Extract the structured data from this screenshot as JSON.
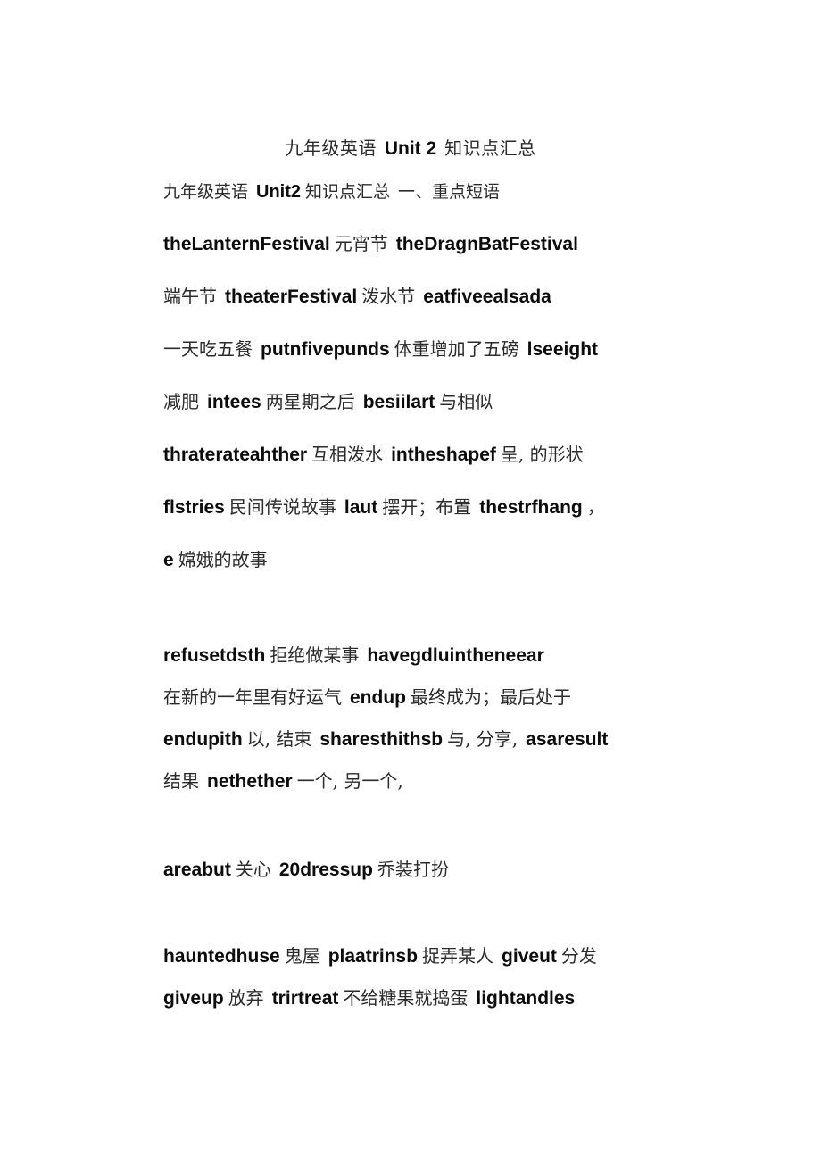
{
  "document": {
    "title_runs": [
      {
        "type": "cn",
        "text": "九年级英语"
      },
      {
        "type": "en",
        "text": "Unit 2"
      },
      {
        "type": "cn",
        "text": "知识点汇总"
      }
    ],
    "title_plain": "九年级英语 Unit 2 知识点汇总",
    "page_background": "#ffffff",
    "text_color": "#111111",
    "blocks": [
      {
        "name": "intro",
        "lines": [
          {
            "plain": "九年级英语 Unit2 知识点汇总 一、重点短语",
            "runs": [
              {
                "type": "cn",
                "text": "九年级英语"
              },
              {
                "type": "en",
                "text": "Unit2"
              },
              {
                "type": "cn",
                "text": "知识点汇总"
              },
              {
                "type": "cn",
                "text": "一、重点短语"
              }
            ]
          }
        ]
      },
      {
        "name": "phrases-group-1",
        "lines": [
          {
            "plain": "theLanternFestival 元宵节 theDragnBatFestival",
            "runs": [
              {
                "type": "en",
                "text": "theLanternFestival"
              },
              {
                "type": "cn",
                "text": "元宵节"
              },
              {
                "type": "en",
                "text": "theDragnBatFestival"
              }
            ]
          },
          {
            "plain": "端午节 theaterFestival 泼水节 eatfiveealsada",
            "runs": [
              {
                "type": "cn",
                "text": "端午节"
              },
              {
                "type": "en",
                "text": "theaterFestival"
              },
              {
                "type": "cn",
                "text": "泼水节"
              },
              {
                "type": "en",
                "text": "eatfiveealsada"
              }
            ]
          },
          {
            "plain": "一天吃五餐 putnfivepunds 体重增加了五磅 lseeight",
            "runs": [
              {
                "type": "cn",
                "text": "一天吃五餐"
              },
              {
                "type": "en",
                "text": "putnfivepunds"
              },
              {
                "type": "cn",
                "text": "体重增加了五磅"
              },
              {
                "type": "en",
                "text": "lseeight"
              }
            ]
          },
          {
            "plain": "减肥 intees 两星期之后 besiilart 与相似",
            "runs": [
              {
                "type": "cn",
                "text": "减肥"
              },
              {
                "type": "en",
                "text": "intees"
              },
              {
                "type": "cn",
                "text": "两星期之后"
              },
              {
                "type": "en",
                "text": "besiilart"
              },
              {
                "type": "cn",
                "text": "与相似"
              }
            ]
          },
          {
            "plain": "thraterateahther 互相泼水 intheshapef 呈, 的形状",
            "runs": [
              {
                "type": "en",
                "text": "thraterateahther"
              },
              {
                "type": "cn",
                "text": "互相泼水"
              },
              {
                "type": "en",
                "text": "intheshapef"
              },
              {
                "type": "cn",
                "text": "呈, 的形状"
              }
            ]
          },
          {
            "plain": "flstries 民间传说故事 laut 摆开；布置 thestrfhang ，",
            "runs": [
              {
                "type": "en",
                "text": "flstries"
              },
              {
                "type": "cn",
                "text": "民间传说故事"
              },
              {
                "type": "en",
                "text": "laut"
              },
              {
                "type": "cn",
                "text": "摆开；布置"
              },
              {
                "type": "en",
                "text": "thestrfhang"
              },
              {
                "type": "cn",
                "text": "，"
              }
            ]
          },
          {
            "plain": "e 嫦娥的故事",
            "runs": [
              {
                "type": "en",
                "text": "e"
              },
              {
                "type": "cn",
                "text": "嫦娥的故事"
              }
            ]
          }
        ]
      },
      {
        "name": "phrases-group-2",
        "lines": [
          {
            "plain": "refusetdsth 拒绝做某事 havegdluintheneear",
            "runs": [
              {
                "type": "en",
                "text": "refusetdsth"
              },
              {
                "type": "cn",
                "text": "拒绝做某事"
              },
              {
                "type": "en",
                "text": "havegdluintheneear"
              }
            ]
          },
          {
            "plain": "在新的一年里有好运气 endup 最终成为；最后处于",
            "runs": [
              {
                "type": "cn",
                "text": "在新的一年里有好运气"
              },
              {
                "type": "en",
                "text": "endup"
              },
              {
                "type": "cn",
                "text": "最终成为；最后处于"
              }
            ]
          },
          {
            "plain": "endupith 以, 结束 sharesthithsb 与, 分享, asaresult",
            "runs": [
              {
                "type": "en",
                "text": "endupith"
              },
              {
                "type": "cn",
                "text": "以, 结束"
              },
              {
                "type": "en",
                "text": "sharesthithsb"
              },
              {
                "type": "cn",
                "text": "与, 分享,"
              },
              {
                "type": "en",
                "text": "asaresult"
              }
            ]
          },
          {
            "plain": "结果 nethether 一个, 另一个,",
            "runs": [
              {
                "type": "cn",
                "text": "结果"
              },
              {
                "type": "en",
                "text": "nethether"
              },
              {
                "type": "cn",
                "text": "一个, 另一个,"
              }
            ]
          }
        ]
      },
      {
        "name": "phrases-group-3",
        "lines": [
          {
            "plain": "areabut 关心 20dressup 乔装打扮",
            "runs": [
              {
                "type": "en",
                "text": "areabut"
              },
              {
                "type": "cn",
                "text": "关心"
              },
              {
                "type": "en",
                "text": "20dressup"
              },
              {
                "type": "cn",
                "text": "乔装打扮"
              }
            ]
          }
        ]
      },
      {
        "name": "phrases-group-4",
        "lines": [
          {
            "plain": "hauntedhuse 鬼屋 plaatrinsb 捉弄某人 giveut 分发",
            "runs": [
              {
                "type": "en",
                "text": "hauntedhuse"
              },
              {
                "type": "cn",
                "text": "鬼屋"
              },
              {
                "type": "en",
                "text": "plaatrinsb"
              },
              {
                "type": "cn",
                "text": "捉弄某人"
              },
              {
                "type": "en",
                "text": "giveut"
              },
              {
                "type": "cn",
                "text": "分发"
              }
            ]
          },
          {
            "plain": "giveup 放弃 trirtreat 不给糖果就捣蛋 lightandles",
            "runs": [
              {
                "type": "en",
                "text": "giveup"
              },
              {
                "type": "cn",
                "text": "放弃"
              },
              {
                "type": "en",
                "text": "trirtreat"
              },
              {
                "type": "cn",
                "text": "不给糖果就捣蛋"
              },
              {
                "type": "en",
                "text": "lightandles"
              }
            ]
          }
        ]
      }
    ]
  }
}
